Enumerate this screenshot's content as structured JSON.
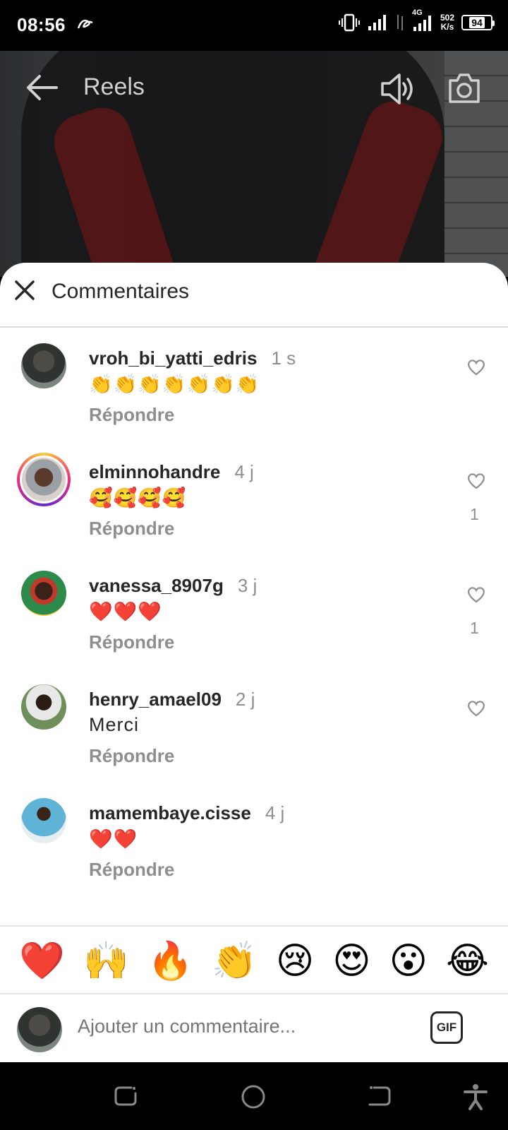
{
  "status_bar": {
    "time": "08:56",
    "network": "4G",
    "speed_value": "502",
    "speed_unit": "K/s",
    "battery": "94"
  },
  "header": {
    "title": "Reels"
  },
  "sheet": {
    "title": "Commentaires"
  },
  "comments": [
    {
      "username": "vroh_bi_yatti_edris",
      "time": "1 s",
      "text": "👏👏👏👏👏👏👏",
      "reply": "Répondre",
      "likes": ""
    },
    {
      "username": "elminnohandre",
      "time": "4 j",
      "text": "🥰🥰🥰🥰",
      "reply": "Répondre",
      "likes": "1"
    },
    {
      "username": "vanessa_8907g",
      "time": "3 j",
      "text": "❤️❤️❤️",
      "reply": "Répondre",
      "likes": "1"
    },
    {
      "username": "henry_amael09",
      "time": "2 j",
      "text": "Merci",
      "reply": "Répondre",
      "likes": ""
    },
    {
      "username": "mamembaye.cisse",
      "time": "4 j",
      "text": "❤️❤️",
      "reply": "Répondre",
      "likes": ""
    }
  ],
  "reactions": [
    "❤️",
    "🙌",
    "🔥",
    "👏",
    "😢",
    "😍",
    "😮",
    "😂"
  ],
  "composer": {
    "placeholder": "Ajouter un commentaire...",
    "gif_label": "GIF"
  },
  "colors": {
    "text": "#262626",
    "muted": "#8e8e8e",
    "divider": "#dbdbdb"
  }
}
